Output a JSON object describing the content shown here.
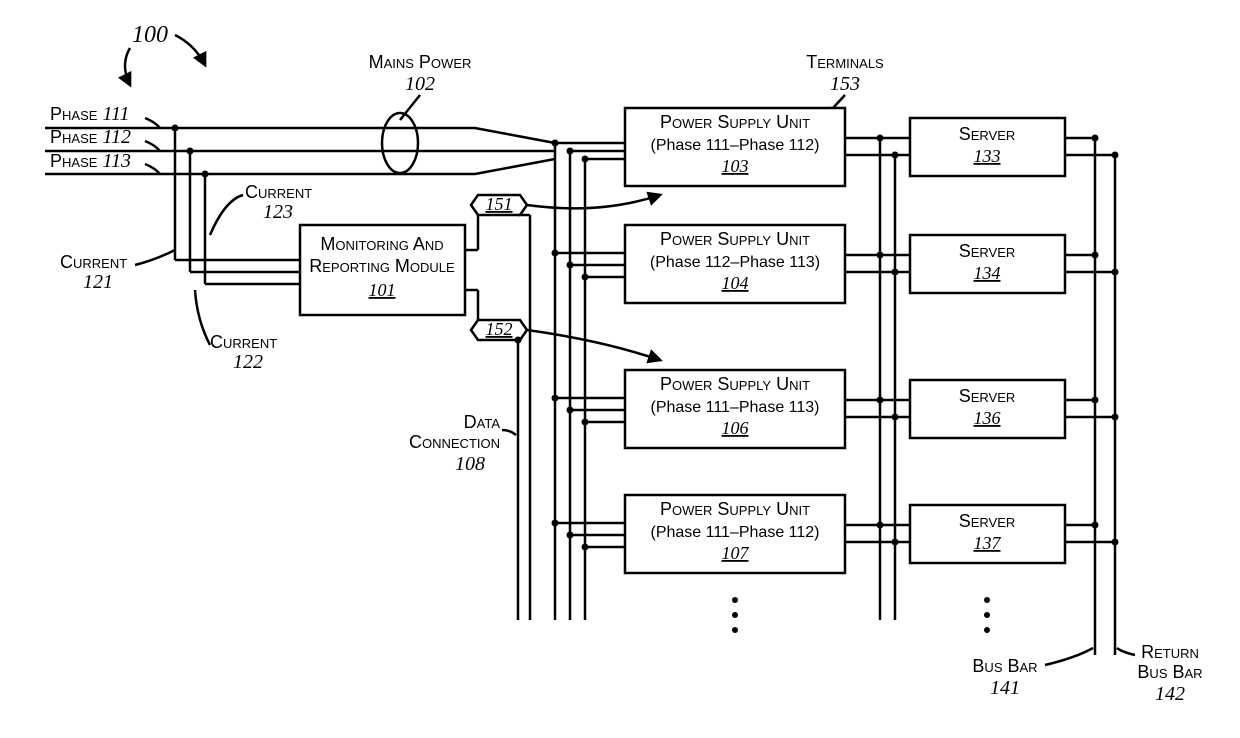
{
  "figure_number": "100",
  "mains_power": {
    "label": "Mains Power",
    "ref": "102"
  },
  "terminals": {
    "label": "Terminals",
    "ref": "153"
  },
  "phases": {
    "p1": {
      "label": "Phase",
      "ref": "111"
    },
    "p2": {
      "label": "Phase",
      "ref": "112"
    },
    "p3": {
      "label": "Phase",
      "ref": "113"
    }
  },
  "currents": {
    "c1": {
      "label": "Current",
      "ref": "121"
    },
    "c2": {
      "label": "Current",
      "ref": "122"
    },
    "c3": {
      "label": "Current",
      "ref": "123"
    }
  },
  "monitoring": {
    "label_l1": "Monitoring And",
    "label_l2": "Reporting Module",
    "ref": "101"
  },
  "control_links": {
    "a": "151",
    "b": "152"
  },
  "data_connection": {
    "label_l1": "Data",
    "label_l2": "Connection",
    "ref": "108"
  },
  "psus": {
    "psu103": {
      "l1": "Power Supply Unit",
      "l2": "(Phase 111–Phase 112)",
      "ref": "103"
    },
    "psu104": {
      "l1": "Power Supply Unit",
      "l2": "(Phase 112–Phase 113)",
      "ref": "104"
    },
    "psu106": {
      "l1": "Power Supply Unit",
      "l2": "(Phase 111–Phase 113)",
      "ref": "106"
    },
    "psu107": {
      "l1": "Power Supply Unit",
      "l2": "(Phase 111–Phase 112)",
      "ref": "107"
    }
  },
  "servers": {
    "s133": {
      "label": "Server",
      "ref": "133"
    },
    "s134": {
      "label": "Server",
      "ref": "134"
    },
    "s136": {
      "label": "Server",
      "ref": "136"
    },
    "s137": {
      "label": "Server",
      "ref": "137"
    }
  },
  "bus_bar": {
    "label": "Bus Bar",
    "ref": "141"
  },
  "return_bus_bar": {
    "label_l1": "Return",
    "label_l2": "Bus Bar",
    "ref": "142"
  }
}
